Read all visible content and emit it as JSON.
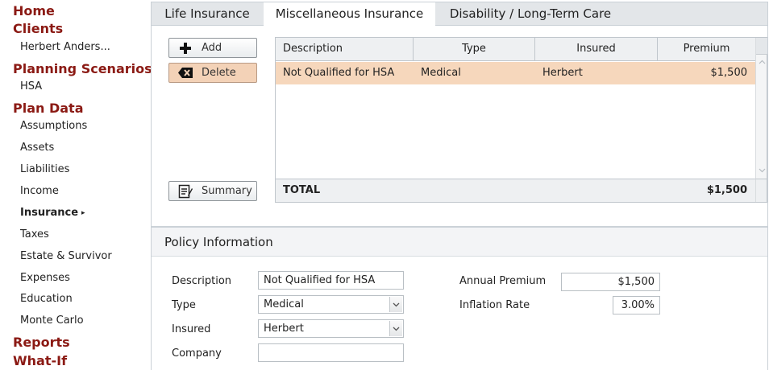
{
  "sidebar": {
    "home": "Home",
    "clients": "Clients",
    "client_name": "Herbert Anders...",
    "planning_scenarios": "Planning Scenarios",
    "scenario_hsa": "HSA",
    "plan_data": "Plan Data",
    "items": [
      {
        "label": "Assumptions"
      },
      {
        "label": "Assets"
      },
      {
        "label": "Liabilities"
      },
      {
        "label": "Income"
      },
      {
        "label": "Insurance"
      },
      {
        "label": "Taxes"
      },
      {
        "label": "Estate & Survivor"
      },
      {
        "label": "Expenses"
      },
      {
        "label": "Education"
      },
      {
        "label": "Monte Carlo"
      }
    ],
    "active_caret": "▸",
    "reports": "Reports",
    "whatif": "What-If"
  },
  "tabs": [
    {
      "label": "Life Insurance"
    },
    {
      "label": "Miscellaneous Insurance"
    },
    {
      "label": "Disability / Long-Term Care"
    }
  ],
  "buttons": {
    "add": "Add",
    "delete": "Delete",
    "summary": "Summary"
  },
  "grid": {
    "columns": [
      "Description",
      "Type",
      "Insured",
      "Premium"
    ],
    "rows": [
      {
        "description": "Not Qualified for HSA",
        "type": "Medical",
        "insured": "Herbert",
        "premium": "$1,500"
      }
    ],
    "total_label": "TOTAL",
    "total_value": "$1,500"
  },
  "policy": {
    "title": "Policy Information",
    "description_label": "Description",
    "description_value": "Not Qualified for HSA",
    "type_label": "Type",
    "type_value": "Medical",
    "insured_label": "Insured",
    "insured_value": "Herbert",
    "company_label": "Company",
    "company_value": "",
    "annual_premium_label": "Annual Premium",
    "annual_premium_value": "$1,500",
    "inflation_rate_label": "Inflation Rate",
    "inflation_rate_value": "3.00%"
  },
  "colors": {
    "brand": "#8b1a14",
    "selected_row": "#f6d7bc",
    "delete_button": "#f3d2b7"
  },
  "icons": {
    "add": "plus-icon",
    "delete": "backspace-icon",
    "summary": "summary-icon",
    "dropdown": "chevron-down-icon",
    "scroll_up": "chevron-up-icon",
    "scroll_down": "chevron-down-icon"
  }
}
